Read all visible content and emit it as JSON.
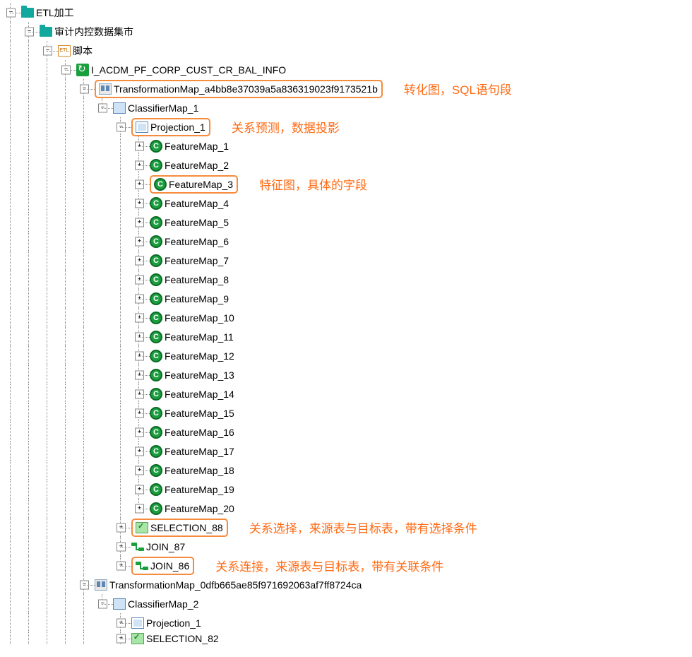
{
  "root": {
    "label": "ETL加工",
    "child": {
      "label": "审计内控数据集市",
      "child": {
        "label": "脚本",
        "etl_text": "ETL",
        "child": {
          "label": "I_ACDM_PF_CORP_CUST_CR_BAL_INFO",
          "tmap1": {
            "label": "TransformationMap_a4bb8e37039a5a836319023f9173521b",
            "annotation": "转化图，SQL语句段",
            "classifier": {
              "label": "ClassifierMap_1",
              "projection": {
                "label": "Projection_1",
                "annotation": "关系预测，数据投影",
                "features": [
                  "FeatureMap_1",
                  "FeatureMap_2",
                  "FeatureMap_3",
                  "FeatureMap_4",
                  "FeatureMap_5",
                  "FeatureMap_6",
                  "FeatureMap_7",
                  "FeatureMap_8",
                  "FeatureMap_9",
                  "FeatureMap_10",
                  "FeatureMap_11",
                  "FeatureMap_12",
                  "FeatureMap_13",
                  "FeatureMap_14",
                  "FeatureMap_15",
                  "FeatureMap_16",
                  "FeatureMap_17",
                  "FeatureMap_18",
                  "FeatureMap_19",
                  "FeatureMap_20"
                ],
                "feature_annotation": "特征图，具体的字段"
              },
              "selection": {
                "label": "SELECTION_88",
                "annotation": "关系选择，来源表与目标表，带有选择条件"
              },
              "join87": {
                "label": "JOIN_87"
              },
              "join86": {
                "label": "JOIN_86",
                "annotation": "关系连接，来源表与目标表，带有关联条件"
              }
            }
          },
          "tmap2": {
            "label": "TransformationMap_0dfb665ae85f971692063af7ff8724ca",
            "classifier": {
              "label": "ClassifierMap_2",
              "projection": {
                "label": "Projection_1"
              },
              "selection": {
                "label": "SELECTION_82"
              }
            }
          }
        }
      }
    }
  }
}
